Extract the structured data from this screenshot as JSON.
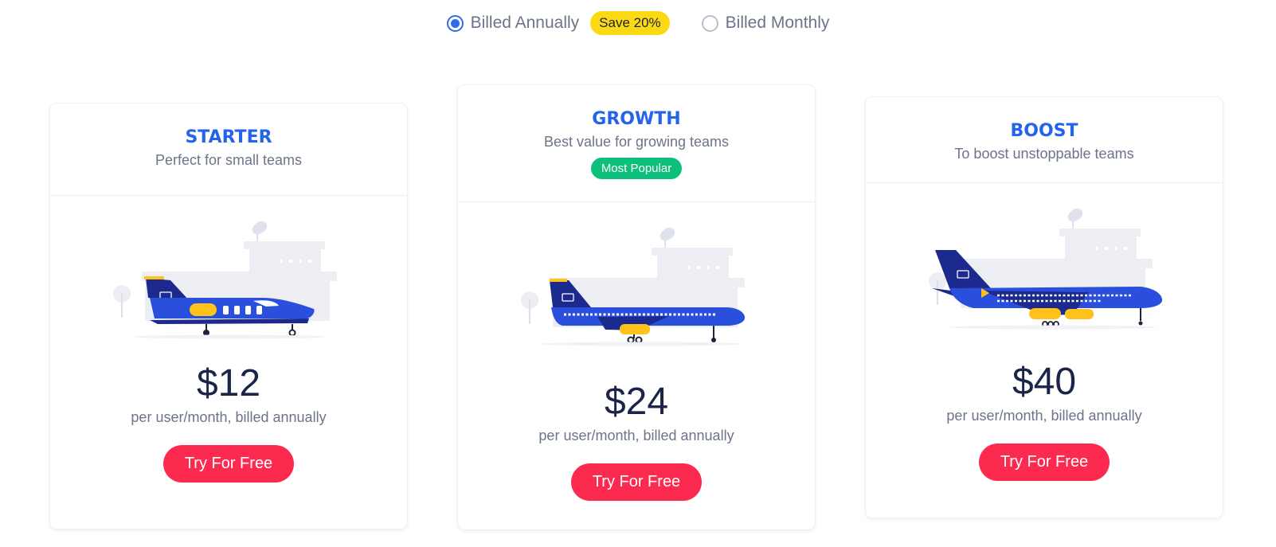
{
  "billing": {
    "annual_label": "Billed Annually",
    "save_badge": "Save 20%",
    "monthly_label": "Billed Monthly",
    "selected": "annual"
  },
  "plans": [
    {
      "name": "STARTER",
      "description": "Perfect for small teams",
      "price": "$12",
      "price_note": "per user/month, billed annually",
      "cta": "Try For Free",
      "illustration": "business-jet-icon"
    },
    {
      "name": "GROWTH",
      "description": "Best value for growing teams",
      "badge": "Most Popular",
      "price": "$24",
      "price_note": "per user/month, billed annually",
      "cta": "Try For Free",
      "illustration": "airliner-icon"
    },
    {
      "name": "BOOST",
      "description": "To boost unstoppable teams",
      "price": "$40",
      "price_note": "per user/month, billed annually",
      "cta": "Try For Free",
      "illustration": "jumbo-jet-icon"
    }
  ],
  "colors": {
    "accent": "#2463eb",
    "cta": "#fd2a4f",
    "popular": "#0cbf7a",
    "save": "#fcd915",
    "plane": "#2b4fdd",
    "tail": "#1b2a8c",
    "engine": "#ffc21a"
  }
}
